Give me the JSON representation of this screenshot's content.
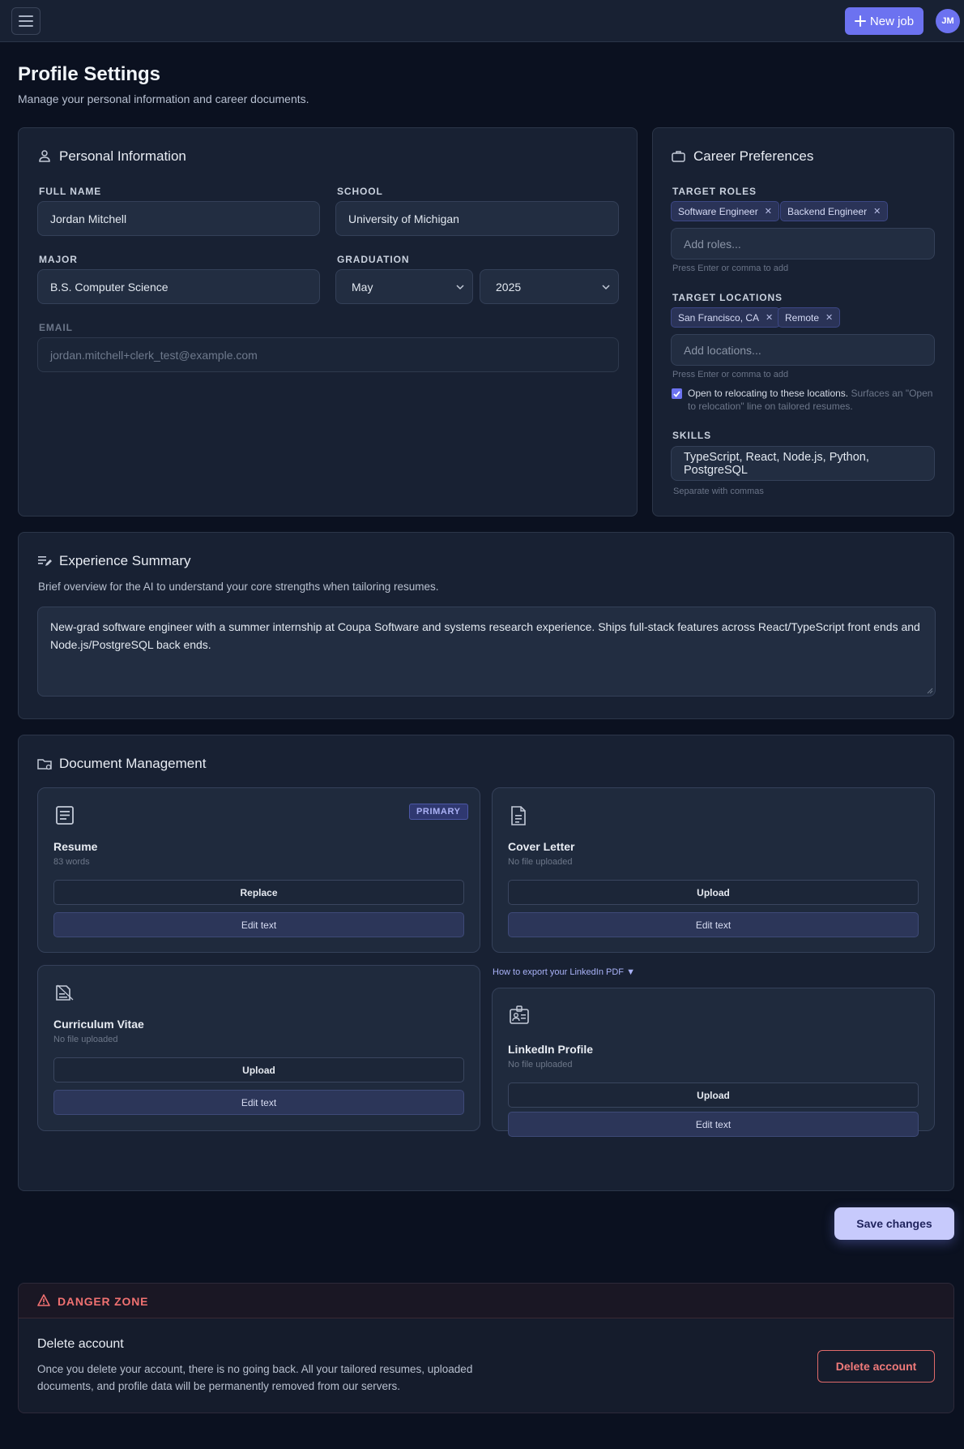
{
  "topbar": {
    "new_job_label": "New job",
    "avatar_initials": "JM"
  },
  "page": {
    "title": "Profile Settings",
    "subtitle": "Manage your personal information and career documents."
  },
  "personal": {
    "title": "Personal Information",
    "full_name_label": "FULL NAME",
    "full_name_value": "Jordan Mitchell",
    "school_label": "SCHOOL",
    "school_value": "University of Michigan",
    "major_label": "MAJOR",
    "major_value": "B.S. Computer Science",
    "graduation_label": "GRADUATION",
    "graduation_month": "May",
    "graduation_year": "2025",
    "email_label": "EMAIL",
    "email_value": "jordan.mitchell+clerk_test@example.com"
  },
  "career": {
    "title": "Career Preferences",
    "roles_label": "TARGET ROLES",
    "roles": [
      "Software Engineer",
      "Backend Engineer"
    ],
    "roles_placeholder": "Add roles...",
    "roles_hint": "Press Enter or comma to add",
    "locations_label": "TARGET LOCATIONS",
    "locations": [
      "San Francisco, CA",
      "Remote"
    ],
    "locations_placeholder": "Add locations...",
    "locations_hint": "Press Enter or comma to add",
    "relocate_label": "Open to relocating to these locations.",
    "relocate_note": "Surfaces an \"Open to relocation\" line on tailored resumes.",
    "relocate_checked": true,
    "skills_label": "SKILLS",
    "skills_value": "TypeScript, React, Node.js, Python, PostgreSQL",
    "skills_hint": "Separate with commas"
  },
  "experience": {
    "title": "Experience Summary",
    "description": "Brief overview for the AI to understand your core strengths when tailoring resumes.",
    "summary": "New-grad software engineer with a summer internship at Coupa Software and systems research experience. Ships full-stack features across React/TypeScript front ends and Node.js/PostgreSQL back ends."
  },
  "documents": {
    "title": "Document Management",
    "resume": {
      "name": "Resume",
      "sub": "83 words",
      "badge": "PRIMARY",
      "primary_btn": "Replace",
      "edit_btn": "Edit text"
    },
    "cover_letter": {
      "name": "Cover Letter",
      "sub": "No file uploaded",
      "primary_btn": "Upload",
      "edit_btn": "Edit text"
    },
    "cv": {
      "name": "Curriculum Vitae",
      "sub": "No file uploaded",
      "primary_btn": "Upload",
      "edit_btn": "Edit text"
    },
    "linkedin_help": "How to export your LinkedIn PDF ▼",
    "linkedin": {
      "name": "LinkedIn Profile",
      "sub": "No file uploaded",
      "primary_btn": "Upload",
      "edit_btn": "Edit text"
    }
  },
  "save_label": "Save changes",
  "danger": {
    "title": "DANGER ZONE",
    "heading": "Delete account",
    "description": "Once you delete your account, there is no going back. All your tailored resumes, uploaded documents, and profile data will be permanently removed from our servers.",
    "button": "Delete account"
  },
  "colors": {
    "background": "#0b1120",
    "card": "#182133",
    "accent": "#6c72f0",
    "danger": "#f07171"
  }
}
